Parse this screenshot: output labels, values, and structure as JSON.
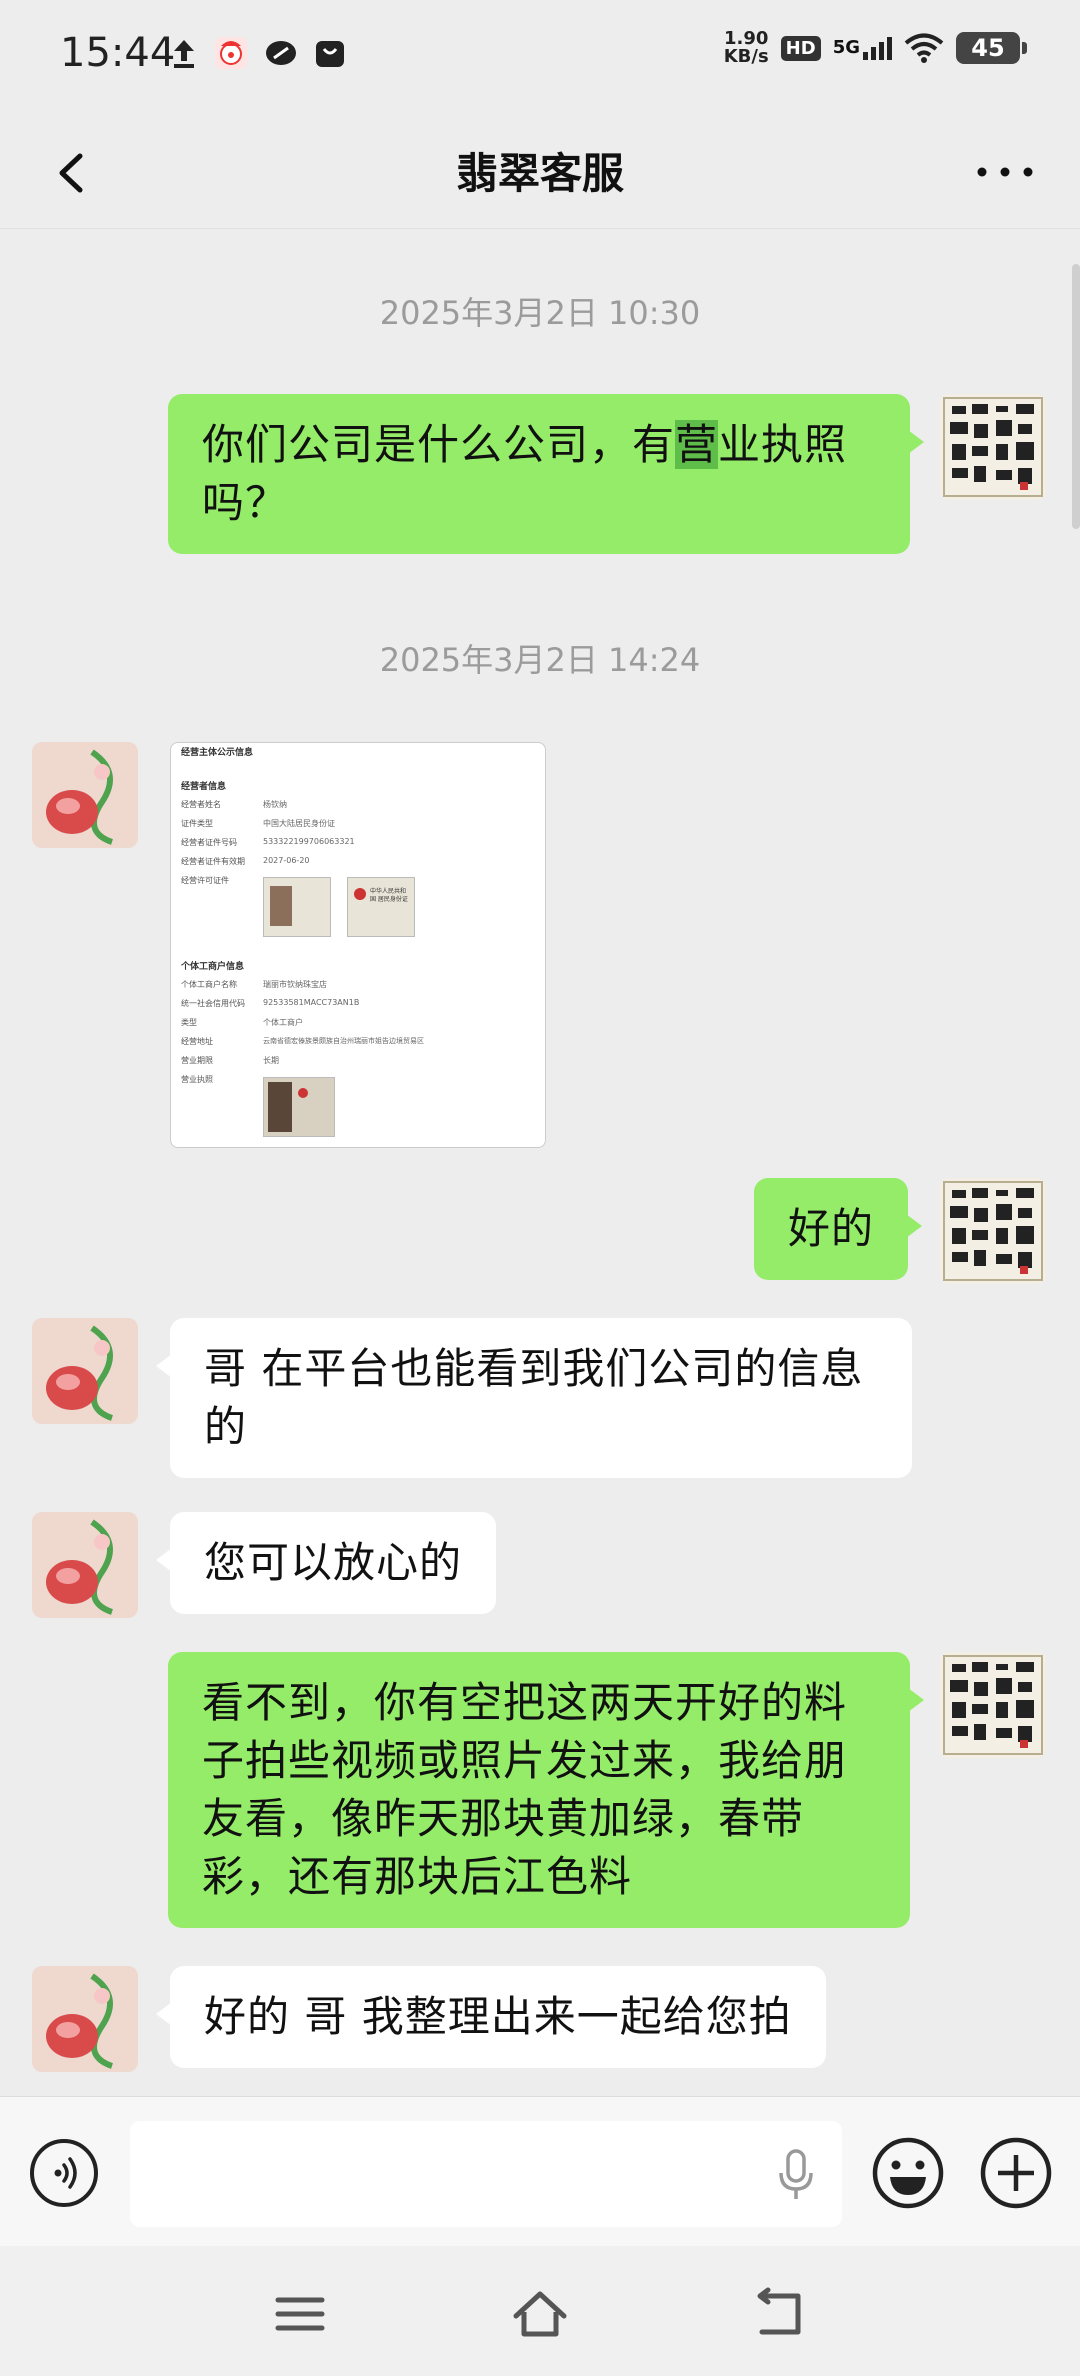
{
  "status_bar": {
    "time": "15:44",
    "net_speed_value": "1.90",
    "net_speed_unit": "KB/s",
    "hd": "HD",
    "network": "5G",
    "battery": "45",
    "icons": [
      "upload-icon",
      "app-clown-icon",
      "link-icon",
      "bag-icon",
      "signal-icon",
      "wifi-icon",
      "battery-icon"
    ]
  },
  "header": {
    "title": "翡翠客服",
    "back_icon": "chevron-left-icon",
    "more_icon": "more-dots-icon"
  },
  "messages": [
    {
      "type": "timestamp",
      "text": "2025年3月2日 10:30"
    },
    {
      "type": "text",
      "side": "right",
      "parts": [
        "你们公司是什么公司，有",
        "营",
        "业执照吗？"
      ]
    },
    {
      "type": "timestamp",
      "text": "2025年3月2日 14:24"
    },
    {
      "type": "image",
      "side": "left",
      "doc": {
        "header": "经营主体公示信息",
        "section1": "经营者信息",
        "rows1": [
          [
            "经营者姓名",
            "杨钦纳"
          ],
          [
            "证件类型",
            "中国大陆居民身份证"
          ],
          [
            "经营者证件号码",
            "533322199706063321"
          ],
          [
            "经营者证件有效期",
            "2027-06-20"
          ],
          [
            "经营许可证件",
            ""
          ]
        ],
        "section2": "个体工商户信息",
        "rows2": [
          [
            "个体工商户名称",
            "瑞丽市钦纳珠宝店"
          ],
          [
            "统一社会信用代码",
            "92533581MACC73AN1B"
          ],
          [
            "类型",
            "个体工商户"
          ],
          [
            "经营地址",
            "云南省德宏傣族景颇族自治州瑞丽市姐告边境贸易区"
          ],
          [
            "营业期限",
            "长期"
          ],
          [
            "营业执照",
            ""
          ]
        ],
        "card_text": "中华人民共和国 居民身份证"
      }
    },
    {
      "type": "text",
      "side": "right",
      "text": "好的"
    },
    {
      "type": "text",
      "side": "left",
      "text": "哥 在平台也能看到我们公司的信息的"
    },
    {
      "type": "text",
      "side": "left",
      "text": "您可以放心的"
    },
    {
      "type": "text",
      "side": "right",
      "text": "看不到，你有空把这两天开好的料子拍些视频或照片发过来，我给朋友看，像昨天那块黄加绿，春带彩，还有那块后江色料"
    },
    {
      "type": "text",
      "side": "left",
      "text": "好的 哥 我整理出来一起给您拍"
    }
  ],
  "input_bar": {
    "voice_icon": "voice-icon",
    "mic_icon": "mic-icon",
    "emoji_icon": "emoji-icon",
    "plus_icon": "plus-icon"
  },
  "nav_bar": {
    "icons": [
      "menu-icon",
      "home-icon",
      "back-icon"
    ]
  },
  "colors": {
    "my_bubble": "#95ec69",
    "their_bubble": "#ffffff",
    "background": "#ededed"
  }
}
